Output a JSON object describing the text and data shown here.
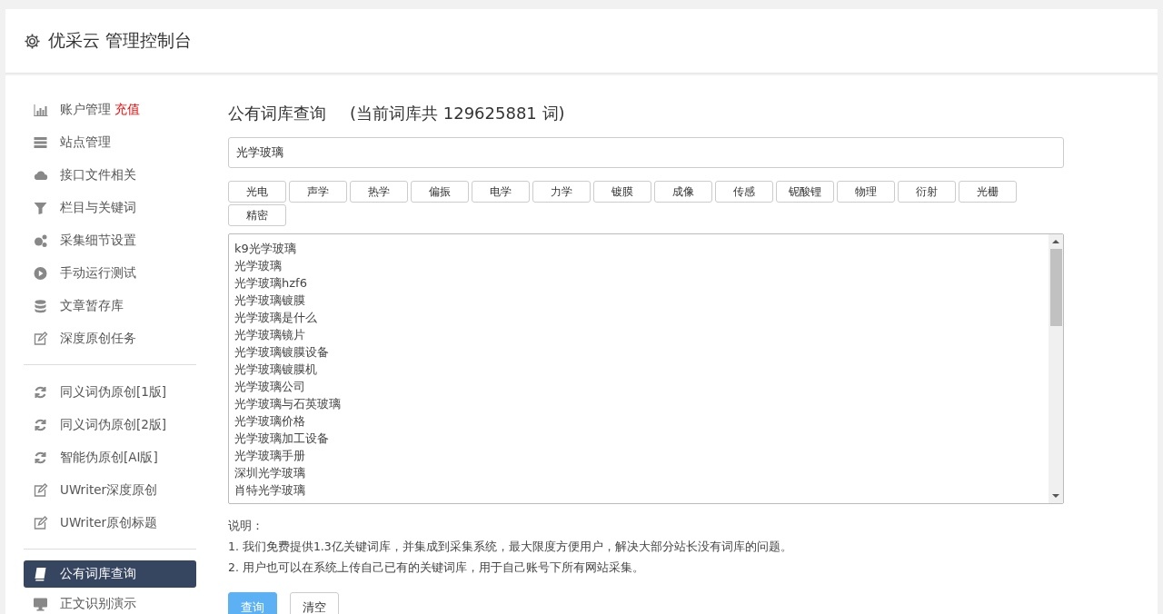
{
  "header": {
    "title": "优采云 管理控制台"
  },
  "sidebar": {
    "groups": [
      {
        "items": [
          {
            "label": "账户管理",
            "badge": "充值",
            "kind": "chart",
            "selected": false
          },
          {
            "label": "站点管理",
            "kind": "server",
            "selected": false
          },
          {
            "label": "接口文件相关",
            "kind": "cloud",
            "selected": false
          },
          {
            "label": "栏目与关键词",
            "kind": "filter",
            "selected": false
          },
          {
            "label": "采集细节设置",
            "kind": "gears",
            "selected": false
          },
          {
            "label": "手动运行测试",
            "kind": "play",
            "selected": false
          },
          {
            "label": "文章暂存库",
            "kind": "database",
            "selected": false
          },
          {
            "label": "深度原创任务",
            "kind": "edit",
            "selected": false
          }
        ]
      },
      {
        "items": [
          {
            "label": "同义词伪原创[1版]",
            "kind": "refresh",
            "selected": false
          },
          {
            "label": "同义词伪原创[2版]",
            "kind": "refresh",
            "selected": false
          },
          {
            "label": "智能伪原创[AI版]",
            "kind": "refresh",
            "selected": false
          },
          {
            "label": "UWriter深度原创",
            "kind": "edit",
            "selected": false
          },
          {
            "label": "UWriter原创标题",
            "kind": "edit",
            "selected": false
          }
        ]
      },
      {
        "items": [
          {
            "label": "公有词库查询",
            "kind": "book",
            "selected": true
          },
          {
            "label": "正文识别演示",
            "kind": "monitor",
            "selected": false
          }
        ]
      }
    ]
  },
  "main": {
    "title": "公有词库查询",
    "subtitle": "(当前词库共 129625881 词)",
    "search": {
      "value": "光学玻璃"
    },
    "tags": [
      "光电",
      "声学",
      "热学",
      "偏振",
      "电学",
      "力学",
      "镀膜",
      "成像",
      "传感",
      "铌酸锂",
      "物理",
      "衍射",
      "光栅",
      "精密"
    ],
    "results": [
      "k9光学玻璃",
      "光学玻璃",
      "光学玻璃hzf6",
      "光学玻璃镀膜",
      "光学玻璃是什么",
      "光学玻璃镜片",
      "光学玻璃镀膜设备",
      "光学玻璃镀膜机",
      "光学玻璃公司",
      "光学玻璃与石英玻璃",
      "光学玻璃价格",
      "光学玻璃加工设备",
      "光学玻璃手册",
      "深圳光学玻璃",
      "肖特光学玻璃"
    ],
    "notes_title": "说明：",
    "notes": [
      "1. 我们免费提供1.3亿关键词库，并集成到采集系统，最大限度方便用户，解决大部分站长没有词库的问题。",
      "2. 用户也可以在系统上传自己已有的关键词库，用于自己账号下所有网站采集。"
    ],
    "buttons": [
      {
        "label": "查询",
        "kind": "primary"
      },
      {
        "label": "清空",
        "kind": "default"
      }
    ]
  }
}
